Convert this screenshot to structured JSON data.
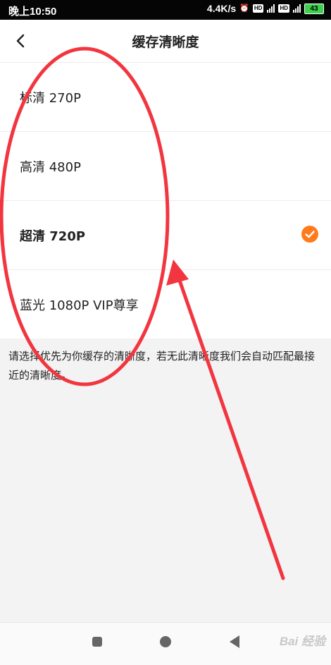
{
  "status_bar": {
    "time": "晚上10:50",
    "network_speed": "4.4K/s",
    "hd_label": "HD",
    "signal_label": "4G",
    "battery": "43"
  },
  "header": {
    "back_icon": "chevron-left-icon",
    "title": "缓存清晰度"
  },
  "options": [
    {
      "label": "标清 270P",
      "selected": false
    },
    {
      "label": "高清 480P",
      "selected": false
    },
    {
      "label": "超清 720P",
      "selected": true
    },
    {
      "label": "蓝光 1080P  VIP尊享",
      "selected": false
    }
  ],
  "note": "请选择优先为你缓存的清晰度，若无此清晰度我们会自动匹配最接近的清晰度。",
  "nav_bar": {
    "recent_icon": "square-icon",
    "home_icon": "circle-icon",
    "back_icon": "triangle-back-icon",
    "watermark": "Bai 经验"
  },
  "colors": {
    "accent": "#ff7a1a",
    "annotation": "#f2353f"
  }
}
